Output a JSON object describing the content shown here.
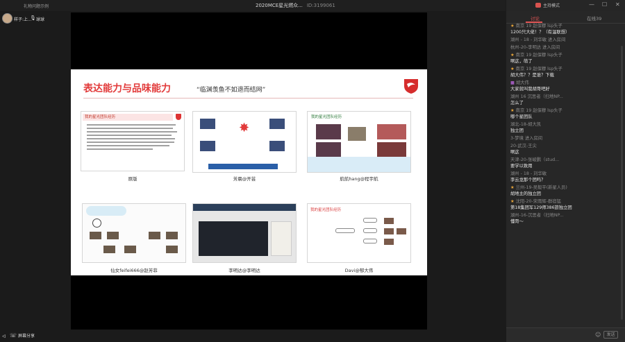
{
  "window": {
    "brand": "礼物问题示例",
    "title": "2020MCE星光燃众...",
    "room_id": "ID:3199061",
    "mode_label": "主持模式",
    "min": "—",
    "max": "☐",
    "close": "✕"
  },
  "participants": [
    {
      "name": "样子:上..."
    },
    {
      "name": "球球"
    }
  ],
  "slide": {
    "title": "表达能力与品味能力",
    "subtitle": "“临渊羡鱼不如退而结网”",
    "thumbs": [
      {
        "caption": "原版",
        "heading": "我的星光团队经历"
      },
      {
        "caption": "芳晨@开芸",
        "heading": ""
      },
      {
        "caption": "航航hang@程宇航",
        "heading": "我的星光团队经历"
      },
      {
        "caption": "仙女feifei666@赵芳菲",
        "heading": ""
      },
      {
        "caption": "李明达@李明达",
        "heading": ""
      },
      {
        "caption": "Davi@郁大伟",
        "heading": "我的星光团队经历"
      }
    ]
  },
  "bottom": {
    "screen_share": "屏幕分享"
  },
  "chat": {
    "tab_chat": "讨论",
    "tab_online": "在线39",
    "messages": [
      {
        "who": "南京 19 赵保穆 lsp头子",
        "text": "1200只大佬！？（有温联想）",
        "style": "star"
      },
      {
        "who": "",
        "text": "",
        "sys": "湖州 - 18 - 刘华敏 进入房间"
      },
      {
        "who": "",
        "text": "",
        "sys": "杭州-20-李明达 进入房间"
      },
      {
        "who": "南京 19 赵保穆 lsp头子",
        "text": "啊这，萌了",
        "style": "star"
      },
      {
        "who": "南京 19 赵保穆 lsp头子",
        "text": "胡大伟？？是谁？下载",
        "style": "star"
      },
      {
        "who": "胡大伟",
        "text": "大家就叫我胡哥吧好",
        "style": "purple"
      },
      {
        "who": "湖州 16 沉思者（扫地NP...",
        "text": "怎么了",
        "style": ""
      },
      {
        "who": "南京 19 赵保穆 lsp头子",
        "text": "哪个星团队",
        "style": "star"
      },
      {
        "who": "湖北-18-胡大凯",
        "text": "独立团",
        "style": ""
      },
      {
        "who": "",
        "text": "",
        "sys": "3-梦境 进入房间"
      },
      {
        "who": "20-武汉-王尖",
        "text": "啊这",
        "style": ""
      },
      {
        "who": "天津-20-张峻鹏（stud...",
        "text": "要学以致用",
        "style": ""
      },
      {
        "who": "湖州 - 18 - 刘华敏",
        "text": "李云龙那个团吗？",
        "style": ""
      },
      {
        "who": "兰州-19-吴毅平(新星人员)",
        "text": "胡地主的独立团",
        "style": "star"
      },
      {
        "who": "沈阳-20-宋雨辉-群宿猛",
        "text": "第18集团军129师386旅独立团",
        "style": "star"
      },
      {
        "who": "湖州-16-沉思者（扫地NP...",
        "text": "懂哥～",
        "style": ""
      }
    ],
    "send": "发送"
  }
}
